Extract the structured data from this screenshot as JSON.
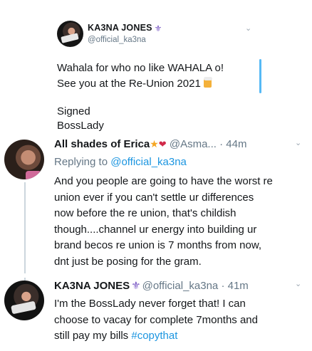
{
  "tweet1": {
    "name": "KA3NA JONES",
    "badge": "⚜",
    "handle": "@official_ka3na",
    "lines": [
      "Wahala for who no like WAHALA o!",
      "See you at the Re-Union 2021"
    ],
    "sign_lines": [
      "Signed",
      "BossLady"
    ]
  },
  "tweet2": {
    "name": "All shades of Erica",
    "emoji_star": "★",
    "emoji_heart": "❤",
    "handle": "@Asma...",
    "time": "· 44m",
    "reply_prefix": "Replying to ",
    "reply_to": "@official_ka3na",
    "lines": [
      "And you people are going to have the worst re",
      "union ever if you can't settle ur differences",
      "now before the re union, that's childish",
      "though....channel ur energy into building ur",
      "brand becos re union is 7 months from now,",
      "dnt just be posing for the gram."
    ]
  },
  "tweet3": {
    "name": "KA3NA JONES",
    "badge": "⚜",
    "handle": "@official_ka3na",
    "time": "· 41m",
    "lines": [
      "I'm the BossLady never forget that! I can",
      "choose to vacay for complete 7months and"
    ],
    "last_line_text": "still pay my bills ",
    "hashtag": "#copythat"
  },
  "icons": {
    "chevron": "chevron-down-icon"
  },
  "colors": {
    "link": "#1b95e0",
    "muted": "#657786",
    "thread": "#ccd6dd",
    "quote_bar": "#1da1f2"
  }
}
